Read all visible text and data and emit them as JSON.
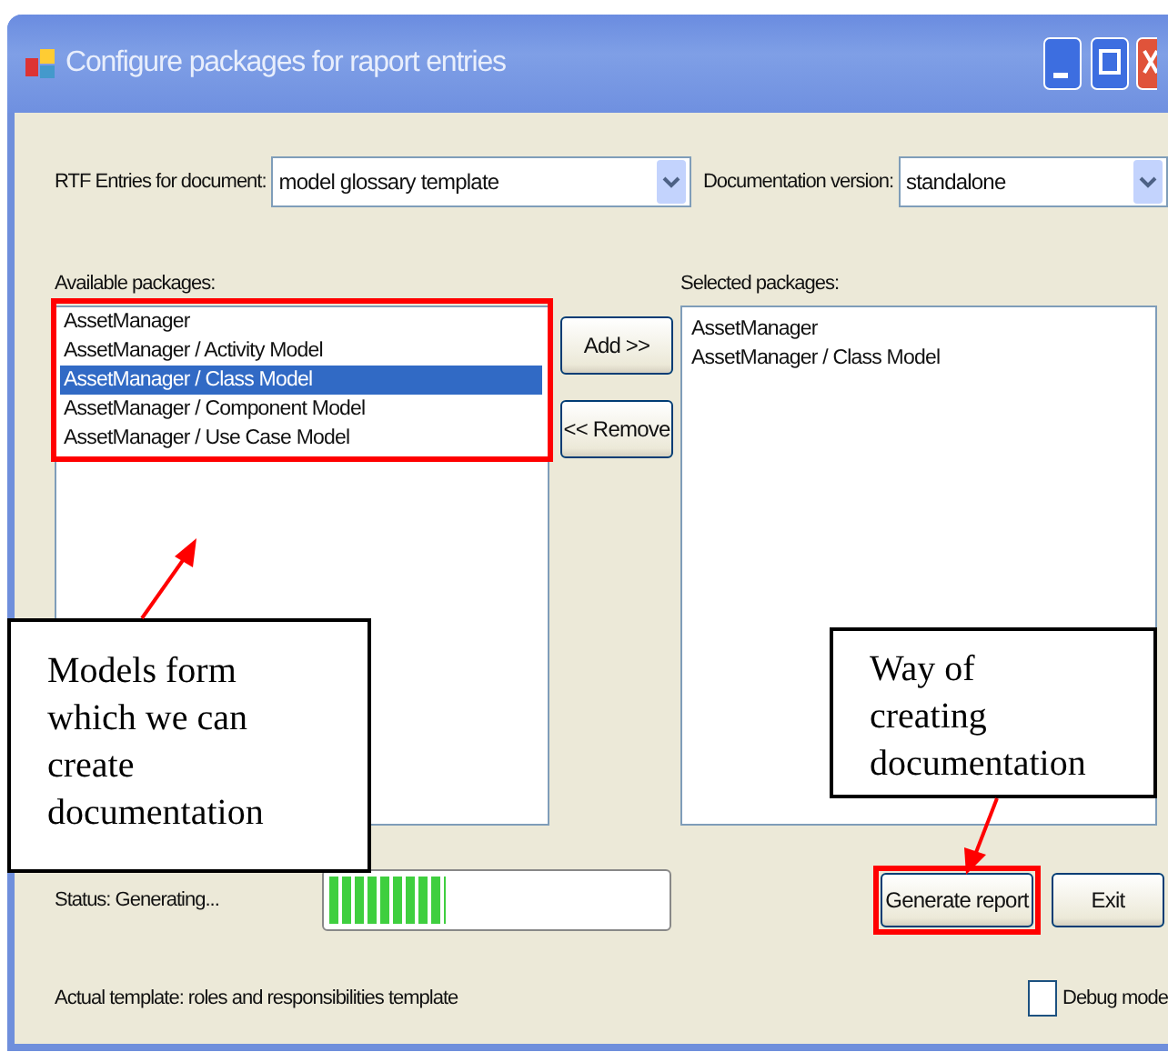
{
  "window": {
    "title": "Configure packages for raport entries"
  },
  "rtf_entries": {
    "label": "RTF Entries for document:",
    "value": "model glossary template"
  },
  "documentation_version": {
    "label": "Documentation version:",
    "value": "standalone"
  },
  "available_packages": {
    "label": "Available packages:",
    "highlighted": true,
    "items": [
      {
        "text": "AssetManager",
        "selected": false
      },
      {
        "text": "AssetManager / Activity Model",
        "selected": false
      },
      {
        "text": "AssetManager / Class Model",
        "selected": true
      },
      {
        "text": "AssetManager / Component Model",
        "selected": false
      },
      {
        "text": "AssetManager / Use Case Model",
        "selected": false
      }
    ]
  },
  "add_button": "Add >>",
  "remove_button": "<< Remove",
  "selected_packages": {
    "label": "Selected packages:",
    "items": [
      {
        "text": "AssetManager",
        "selected": false
      },
      {
        "text": "AssetManager / Class Model",
        "selected": false
      }
    ]
  },
  "status": {
    "text": "Status: Generating...",
    "level": 0.35
  },
  "buttons": [
    {
      "label": "Generate report",
      "highlighted": true
    },
    {
      "label": "Exit",
      "highlighted": false
    }
  ],
  "actual_template": "Actual template: roles and responsibilities template",
  "debug_mode": {
    "label": "Debug mode",
    "checked": false
  },
  "annotations": [
    {
      "text": "Models form which we can create documentation"
    },
    {
      "text": "Way of creating documentation"
    }
  ]
}
